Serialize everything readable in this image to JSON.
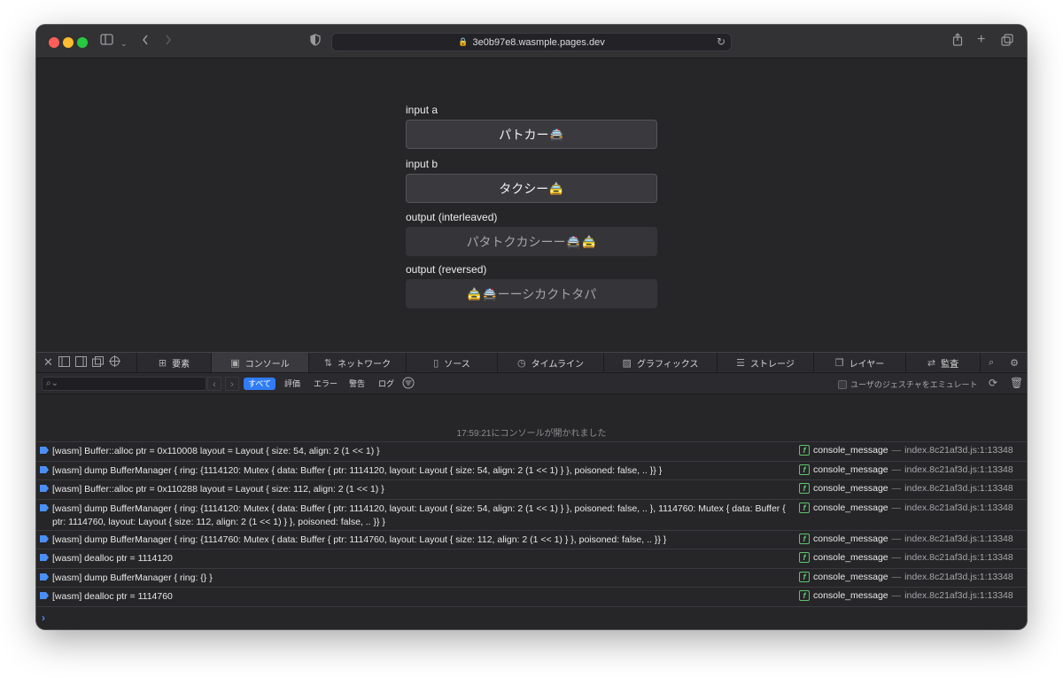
{
  "browser": {
    "url": "3e0b97e8.wasmple.pages.dev",
    "icons": {
      "sidebar": "sidebar-icon",
      "back": "chevron-left-icon",
      "forward": "chevron-right-icon",
      "shield": "shield-icon",
      "lock": "lock-icon",
      "reload": "reload-icon",
      "share": "share-icon",
      "new_tab": "plus-icon",
      "tabs": "tab-overview-icon"
    }
  },
  "page": {
    "fields": [
      {
        "label": "input a",
        "value": "パトカー🚔"
      },
      {
        "label": "input b",
        "value": "タクシー🚖"
      },
      {
        "label": "output (interleaved)",
        "value": "パタトクカシーー🚔🚖"
      },
      {
        "label": "output (reversed)",
        "value": "🚖🚔ーーシカクトタパ"
      }
    ]
  },
  "devtools": {
    "tabs": [
      {
        "label": "要素",
        "icon": "elements-icon"
      },
      {
        "label": "コンソール",
        "icon": "console-icon"
      },
      {
        "label": "ネットワーク",
        "icon": "network-icon"
      },
      {
        "label": "ソース",
        "icon": "sources-icon"
      },
      {
        "label": "タイムライン",
        "icon": "timeline-icon"
      },
      {
        "label": "グラフィックス",
        "icon": "graphics-icon"
      },
      {
        "label": "ストレージ",
        "icon": "storage-icon"
      },
      {
        "label": "レイヤー",
        "icon": "layers-icon"
      },
      {
        "label": "監査",
        "icon": "audit-icon"
      }
    ],
    "active_tab": "コンソール",
    "filter": {
      "levels": [
        "すべて",
        "評価",
        "エラー",
        "警告",
        "ログ"
      ],
      "emulate_label": "ユーザのジェスチャをエミュレート"
    },
    "console": {
      "opened_message": "17:59:21にコンソールが開かれました",
      "source_name": "console_message",
      "source_location": "index.8c21af3d.js:1:13348",
      "messages": [
        "[wasm] Buffer::alloc ptr = 0x110008 layout = Layout { size: 54, align: 2 (1 << 1) }",
        "[wasm] dump BufferManager { ring: {1114120: Mutex { data: Buffer { ptr: 1114120, layout: Layout { size: 54, align: 2 (1 << 1) } }, poisoned: false, .. }} }",
        "[wasm] Buffer::alloc ptr = 0x110288 layout = Layout { size: 112, align: 2 (1 << 1) }",
        "[wasm] dump BufferManager { ring: {1114120: Mutex { data: Buffer { ptr: 1114120, layout: Layout { size: 54, align: 2 (1 << 1) } }, poisoned: false, .. }, 1114760: Mutex { data: Buffer { ptr: 1114760, layout: Layout { size: 112, align: 2 (1 << 1) } }, poisoned: false, .. }} }",
        "[wasm] dump BufferManager { ring: {1114760: Mutex { data: Buffer { ptr: 1114760, layout: Layout { size: 112, align: 2 (1 << 1) } }, poisoned: false, .. }} }",
        "[wasm] dealloc ptr = 1114120",
        "[wasm] dump BufferManager { ring: {} }",
        "[wasm] dealloc ptr = 1114760"
      ]
    }
  }
}
